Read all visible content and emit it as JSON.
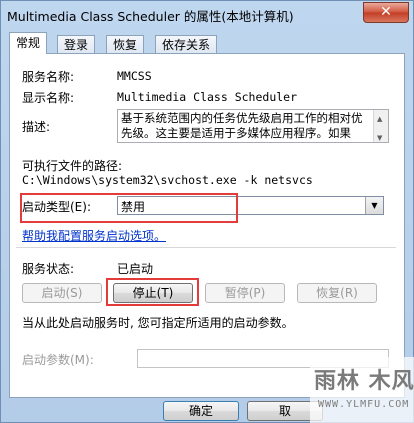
{
  "window": {
    "title": "Multimedia Class Scheduler 的属性(本地计算机)",
    "close_glyph": "✕"
  },
  "tabs": [
    {
      "label": "常规",
      "active": true
    },
    {
      "label": "登录",
      "active": false
    },
    {
      "label": "恢复",
      "active": false
    },
    {
      "label": "依存关系",
      "active": false
    }
  ],
  "general": {
    "service_name_label": "服务名称:",
    "service_name_value": "MMCSS",
    "display_name_label": "显示名称:",
    "display_name_value": "Multimedia Class Scheduler",
    "description_label": "描述:",
    "description_value": "基于系统范围内的任务优先级启用工作的相对优先级。这主要是适用于多媒体应用程序。如果",
    "exec_path_label": "可执行文件的路径:",
    "exec_path_value": "C:\\Windows\\system32\\svchost.exe -k netsvcs",
    "startup_type_label": "启动类型(E):",
    "startup_type_value": "禁用",
    "help_link": "帮助我配置服务启动选项。",
    "status_label": "服务状态:",
    "status_value": "已启动",
    "start_button": "启动(S)",
    "stop_button": "停止(T)",
    "pause_button": "暂停(P)",
    "resume_button": "恢复(R)",
    "hint_text": "当从此处启动服务时, 您可指定所适用的启动参数。",
    "start_params_label": "启动参数(M):",
    "start_params_value": ""
  },
  "footer": {
    "ok_button": "确定",
    "cancel_button": "取"
  },
  "watermark": {
    "big": "雨林 木风",
    "small": "WWW.YLMFU.COM"
  },
  "colors": {
    "highlight_box": "#e43b3b",
    "link": "#0033cc"
  }
}
